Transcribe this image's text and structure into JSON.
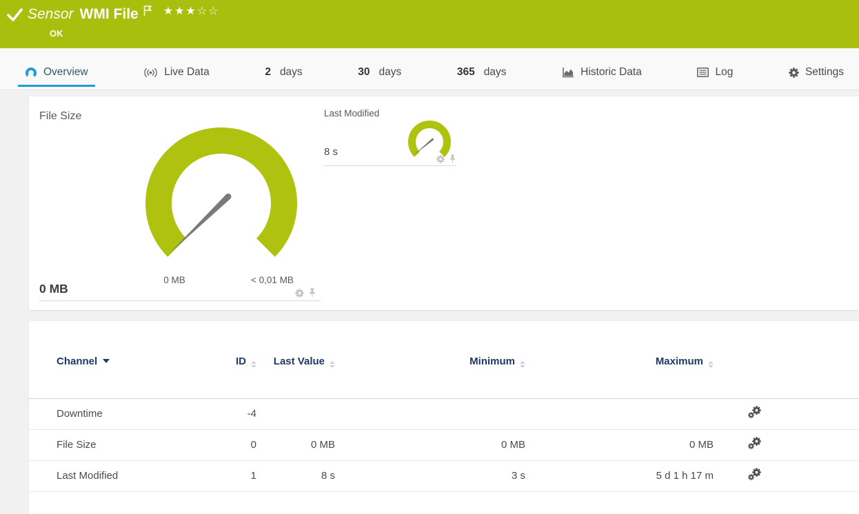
{
  "header": {
    "kind": "Sensor",
    "title": "WMI File",
    "status": "OK",
    "stars": "★★★☆☆"
  },
  "tabs": {
    "overview": "Overview",
    "live_data": "Live Data",
    "d2_num": "2",
    "d2_unit": "days",
    "d30_num": "30",
    "d30_unit": "days",
    "d365_num": "365",
    "d365_unit": "days",
    "historic": "Historic Data",
    "log": "Log",
    "settings": "Settings"
  },
  "file_size_gauge": {
    "title": "File Size",
    "min": "0 MB",
    "max": "< 0,01 MB",
    "value": "0 MB"
  },
  "last_modified_gauge": {
    "title": "Last Modified",
    "value": "8 s"
  },
  "channel_table": {
    "headers": {
      "channel": "Channel",
      "id": "ID",
      "last_value": "Last Value",
      "minimum": "Minimum",
      "maximum": "Maximum"
    },
    "rows": [
      {
        "channel": "Downtime",
        "id": "-4",
        "last_value": "",
        "minimum": "",
        "maximum": ""
      },
      {
        "channel": "File Size",
        "id": "0",
        "last_value": "0 MB",
        "minimum": "0 MB",
        "maximum": "0 MB"
      },
      {
        "channel": "Last Modified",
        "id": "1",
        "last_value": "8 s",
        "minimum": "3 s",
        "maximum": "5 d 1 h 17 m"
      }
    ]
  },
  "colors": {
    "brand_green": "#a9be0d",
    "gauge_green": "#aec20f",
    "accent_blue": "#1e9cd7",
    "header_navy": "#1f3864",
    "needle_gray": "#7a7a7a"
  }
}
